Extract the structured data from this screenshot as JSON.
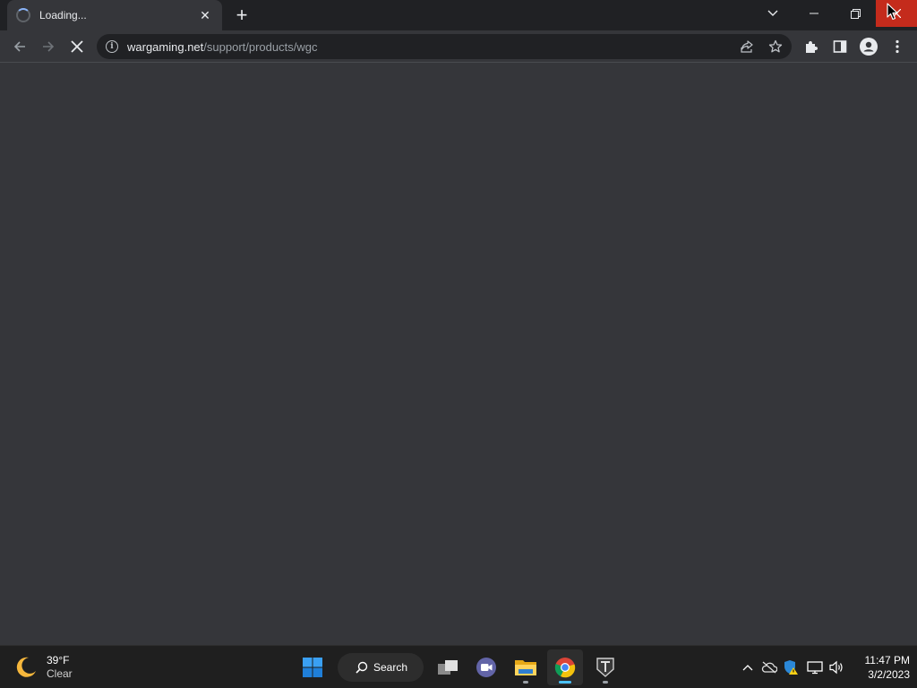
{
  "tab": {
    "title": "Loading...",
    "close_label": "✕",
    "new_tab_label": "+"
  },
  "toolbar": {
    "url_host": "wargaming.net",
    "url_path": "/support/products/wgc",
    "info_glyph": "i"
  },
  "taskbar": {
    "weather_temp": "39°F",
    "weather_condition": "Clear",
    "search_label": "Search",
    "clock_time": "11:47 PM",
    "clock_date": "3/2/2023"
  },
  "colors": {
    "tabstrip_bg": "#202124",
    "page_bg": "#35363a",
    "close_button_bg": "#c42b1c",
    "taskbar_bg": "#1f1f1f",
    "active_indicator": "#4cc2ff"
  },
  "icons": [
    "loading-spinner-icon",
    "close-icon",
    "plus-icon",
    "chevron-down-icon",
    "minimize-icon",
    "restore-icon",
    "back-arrow-icon",
    "forward-arrow-icon",
    "stop-icon",
    "info-icon",
    "share-icon",
    "star-icon",
    "puzzle-icon",
    "side-panel-icon",
    "profile-icon",
    "kebab-menu-icon",
    "moon-icon",
    "windows-start-icon",
    "search-icon",
    "task-view-icon",
    "teams-chat-icon",
    "file-explorer-icon",
    "chrome-icon",
    "world-of-tanks-icon",
    "chevron-up-icon",
    "onedrive-offline-icon",
    "windows-security-warning-icon",
    "network-icon",
    "volume-icon",
    "mouse-cursor-icon"
  ]
}
